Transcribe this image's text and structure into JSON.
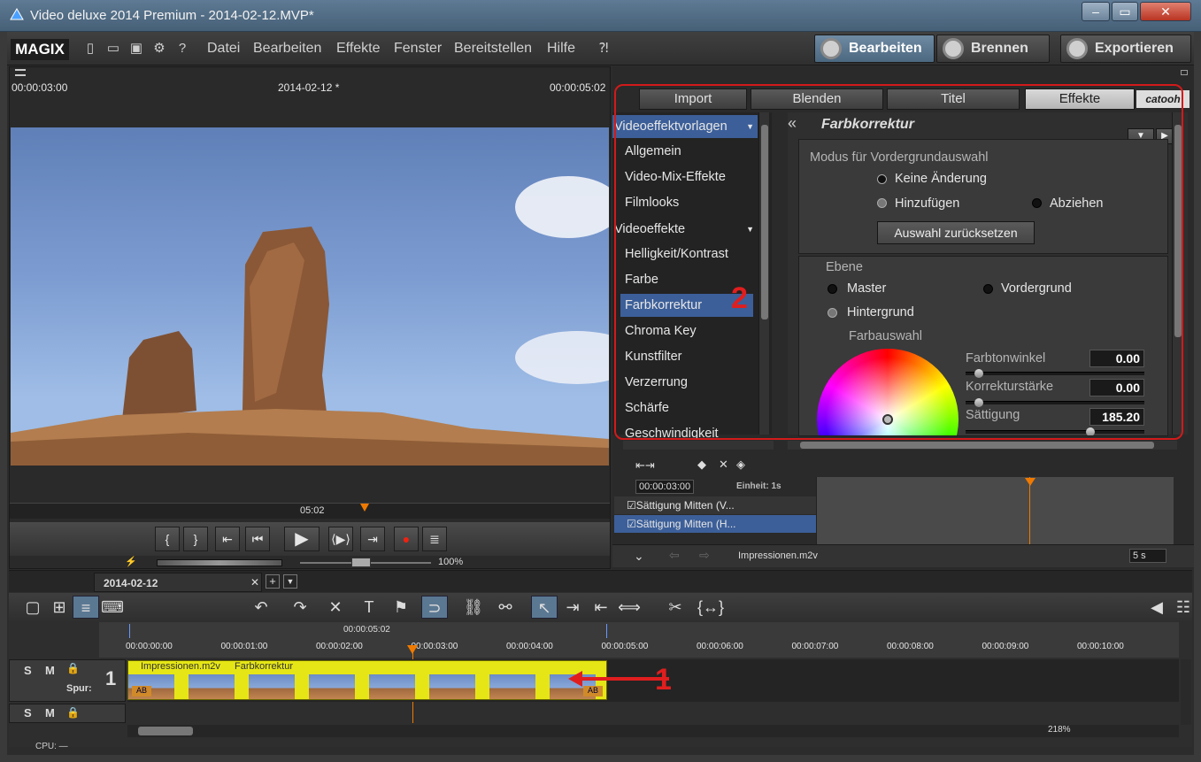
{
  "window": {
    "title": "Video deluxe 2014 Premium - 2014-02-12.MVP*",
    "controls": [
      "–",
      "▭",
      "✕"
    ]
  },
  "menubar": {
    "logo": "MAGIX",
    "items": [
      "Datei",
      "Bearbeiten",
      "Effekte",
      "Fenster",
      "Bereitstellen",
      "Hilfe"
    ],
    "mode_buttons": [
      "Bearbeiten",
      "Brennen"
    ],
    "export": "Exportieren"
  },
  "monitor": {
    "time_left": "00:00:03:00",
    "title": "2014-02-12 *",
    "time_right": "00:00:05:02",
    "position": "05:02",
    "zoom": "100%"
  },
  "panel": {
    "tabs": [
      "Import",
      "Blenden",
      "Titel",
      "Effekte"
    ],
    "brand": "catooh",
    "list_header_templates": "Videoeffektvorlagen",
    "templates": [
      "Allgemein",
      "Video-Mix-Effekte",
      "Filmlooks"
    ],
    "list_header_effects": "Videoeffekte",
    "effects": [
      "Helligkeit/Kontrast",
      "Farbe",
      "Farbkorrektur",
      "Chroma Key",
      "Kunstfilter",
      "Verzerrung",
      "Schärfe",
      "Geschwindigkeit"
    ],
    "detail_title": "Farbkorrektur",
    "mode_label": "Modus für Vordergrundauswahl",
    "mode_options": [
      "Keine Änderung",
      "Hinzufügen",
      "Abziehen"
    ],
    "reset_button": "Auswahl zurücksetzen",
    "layer_label": "Ebene",
    "layers": [
      "Master",
      "Vordergrund",
      "Hintergrund"
    ],
    "color_select_label": "Farbauswahl",
    "params": [
      {
        "label": "Farbtonwinkel",
        "value": "0.00",
        "fraction": 0.05
      },
      {
        "label": "Korrekturstärke",
        "value": "0.00",
        "fraction": 0.05
      },
      {
        "label": "Sättigung",
        "value": "185.20",
        "fraction": 0.71
      }
    ],
    "annotation": "2"
  },
  "keyframes": {
    "time": "00:00:03:00",
    "unit": "Einheit: 1s",
    "rows": [
      "Sättigung Mitten (V...",
      "Sättigung Mitten (H..."
    ],
    "file": "Impressionen.m2v",
    "duration": "5 s"
  },
  "timeline": {
    "tab": "2014-02-12",
    "range_label": "00:00:05:02",
    "ticks": [
      "00:00:00:00",
      "00:00:01:00",
      "00:00:02:00",
      "00:00:03:00",
      "00:00:04:00",
      "00:00:05:00",
      "00:00:06:00",
      "00:00:07:00",
      "00:00:08:00",
      "00:00:09:00",
      "00:00:10:00"
    ],
    "track_label": "Spur:",
    "track_number": "1",
    "clip_file": "Impressionen.m2v",
    "clip_effect": "Farbkorrektur",
    "annotation": "1",
    "zoom": "218%",
    "status": "CPU: —"
  }
}
